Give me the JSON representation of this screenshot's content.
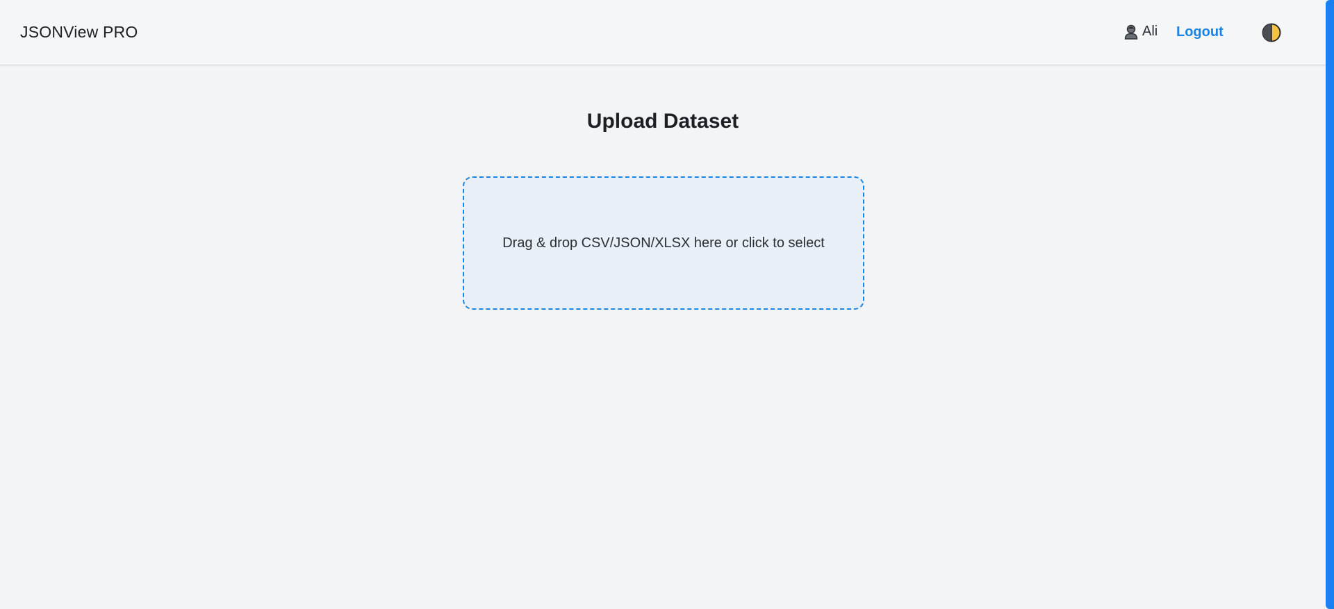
{
  "header": {
    "brand": "JSONView PRO",
    "user_icon": "user-avatar-icon",
    "username": "Ali",
    "logout_label": "Logout",
    "theme_icon": "half-moon-theme-icon"
  },
  "main": {
    "title": "Upload Dataset",
    "dropzone_text": "Drag & drop CSV/JSON/XLSX here or click to select"
  },
  "colors": {
    "accent": "#1a84e3",
    "background": "#f3f4f6",
    "dropzone_bg": "#e9eff6",
    "theme_icon_fill": "#f5c242"
  }
}
